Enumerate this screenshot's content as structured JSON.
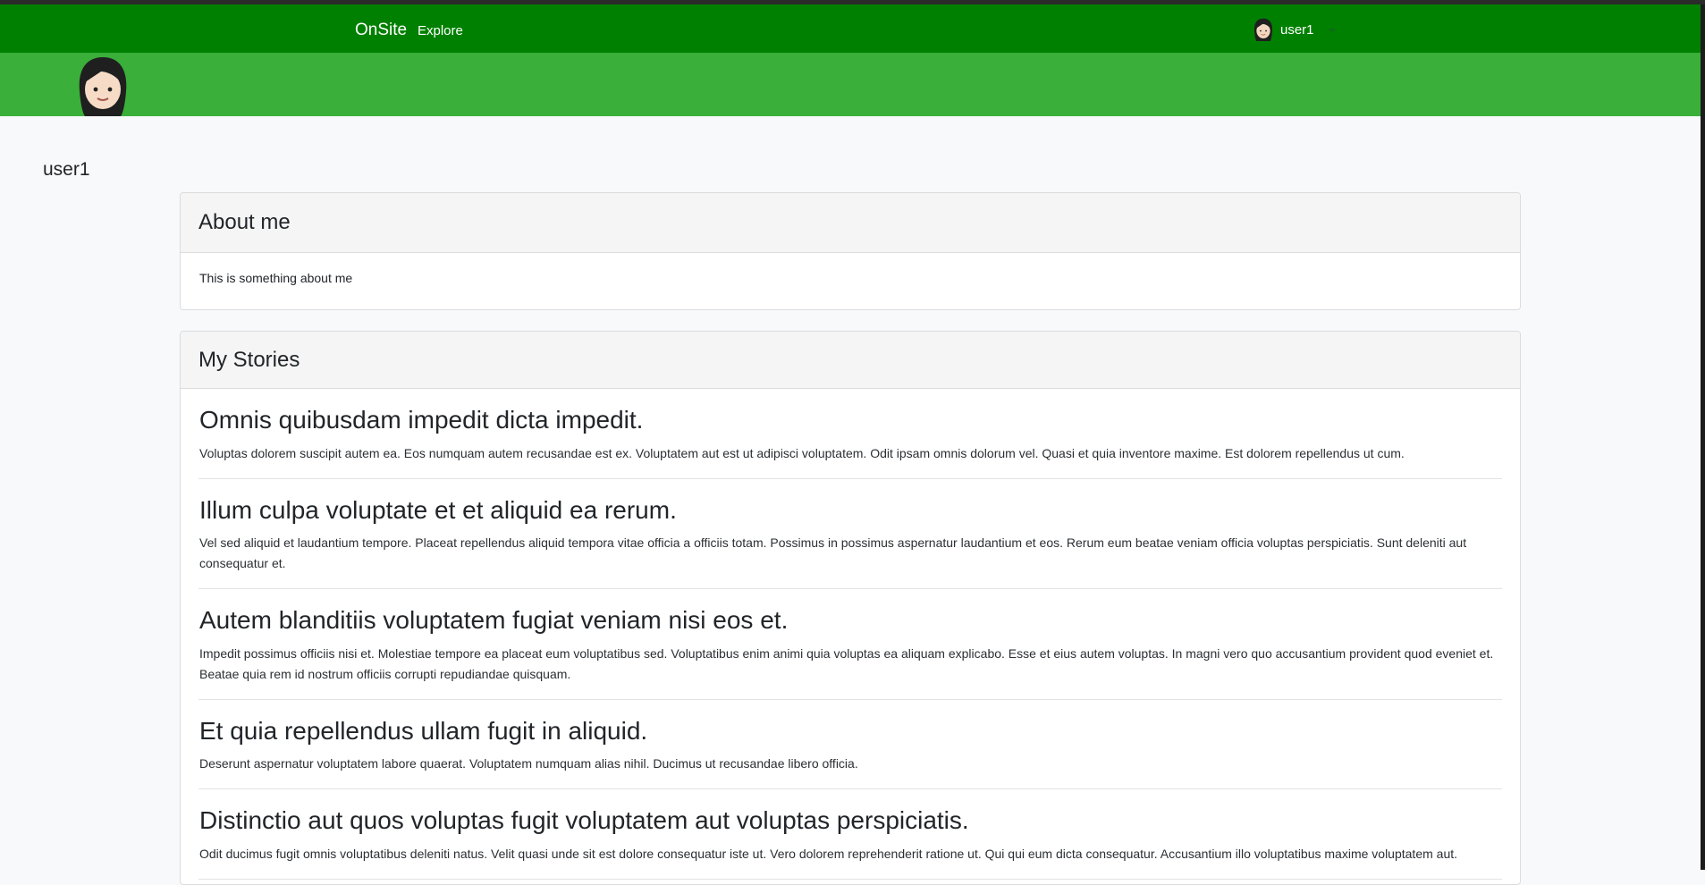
{
  "navbar": {
    "brand": "OnSite",
    "links": [
      "Explore"
    ],
    "user_name": "user1",
    "avatar_icon": "woman-avatar-icon"
  },
  "banner": {
    "avatar_icon": "woman-avatar-icon"
  },
  "profile": {
    "name": "user1"
  },
  "about": {
    "title": "About me",
    "text": "This is something about me"
  },
  "stories": {
    "title": "My Stories",
    "items": [
      {
        "title": "Omnis quibusdam impedit dicta impedit.",
        "body": "Voluptas dolorem suscipit autem ea. Eos numquam autem recusandae est ex. Voluptatem aut est ut adipisci voluptatem. Odit ipsam omnis dolorum vel. Quasi et quia inventore maxime. Est dolorem repellendus ut cum."
      },
      {
        "title": "Illum culpa voluptate et et aliquid ea rerum.",
        "body": "Vel sed aliquid et laudantium tempore. Placeat repellendus aliquid tempora vitae officia a officiis totam. Possimus in possimus aspernatur laudantium et eos. Rerum eum beatae veniam officia voluptas perspiciatis. Sunt deleniti aut consequatur et."
      },
      {
        "title": "Autem blanditiis voluptatem fugiat veniam nisi eos et.",
        "body": "Impedit possimus officiis nisi et. Molestiae tempore ea placeat eum voluptatibus sed. Voluptatibus enim animi quia voluptas ea aliquam explicabo. Esse et eius autem voluptas. In magni vero quo accusantium provident quod eveniet et. Beatae quia rem id nostrum officiis corrupti repudiandae quisquam."
      },
      {
        "title": "Et quia repellendus ullam fugit in aliquid.",
        "body": "Deserunt aspernatur voluptatem labore quaerat. Voluptatem numquam alias nihil. Ducimus ut recusandae libero officia."
      },
      {
        "title": "Distinctio aut quos voluptas fugit voluptatem aut voluptas perspiciatis.",
        "body": "Odit ducimus fugit omnis voluptatibus deleniti natus. Velit quasi unde sit est dolore consequatur iste ut. Vero dolorem reprehenderit ratione ut. Qui qui eum dicta consequatur. Accusantium illo voluptatibus maxime voluptatem aut."
      }
    ]
  },
  "colors": {
    "navbar": "#008000",
    "banner": "#3aaf3a",
    "background": "#f8f9fa"
  }
}
